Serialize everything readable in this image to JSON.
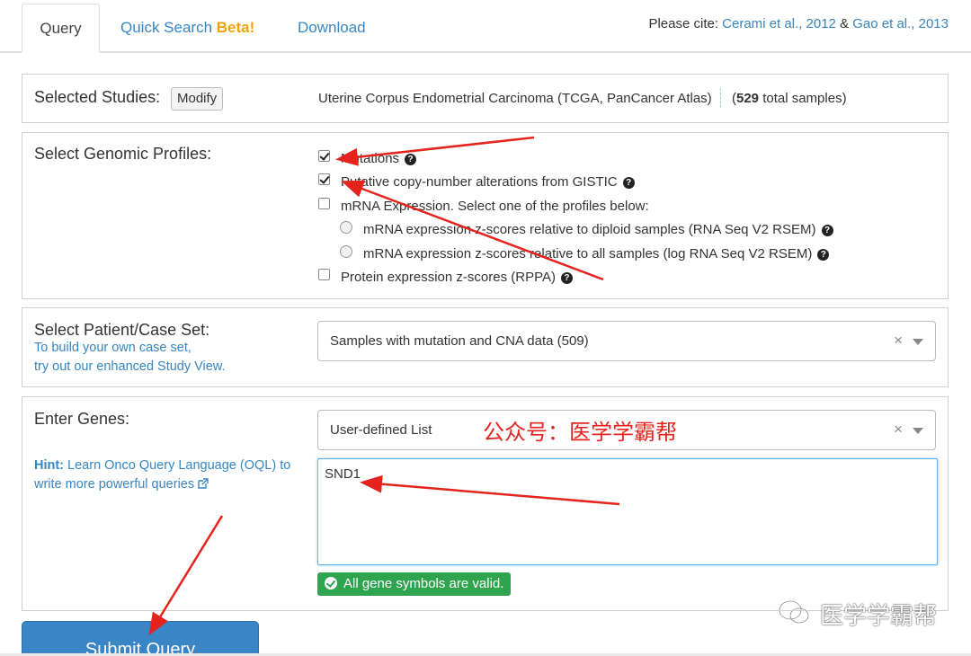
{
  "tabs": {
    "query": "Query",
    "quick_search": "Quick Search",
    "quick_search_badge": "Beta!",
    "download": "Download"
  },
  "cite": {
    "prefix": "Please cite: ",
    "ref1": "Cerami et al., 2012",
    "amp": " & ",
    "ref2": "Gao et al., 2013"
  },
  "studies": {
    "label": "Selected Studies:",
    "modify": "Modify",
    "study_name": "Uterine Corpus Endometrial Carcinoma (TCGA, PanCancer Atlas)",
    "count_open": "(",
    "count": "529",
    "count_suffix": " total samples)"
  },
  "profiles": {
    "label": "Select Genomic Profiles:",
    "options": [
      {
        "label": "Mutations",
        "checked": true
      },
      {
        "label": "Putative copy-number alterations from GISTIC",
        "checked": true
      },
      {
        "label": "mRNA Expression. Select one of the profiles below:",
        "checked": false
      },
      {
        "label": "mRNA expression z-scores relative to diploid samples (RNA Seq V2 RSEM)",
        "selected": false
      },
      {
        "label": "mRNA expression z-scores relative to all samples (log RNA Seq V2 RSEM)",
        "selected": false
      },
      {
        "label": "Protein expression z-scores (RPPA)",
        "checked": false
      }
    ]
  },
  "caseset": {
    "label": "Select Patient/Case Set:",
    "link1": "To build your own case set,",
    "link2": "try out our enhanced Study View.",
    "selected": "Samples with mutation and CNA data (509)"
  },
  "genes": {
    "label": "Enter Genes:",
    "list_selected": "User-defined List",
    "hint_bold": "Hint:",
    "hint_text": " Learn Onco Query Language (OQL) to write more powerful queries",
    "input_value": "SND1",
    "valid_msg": "All gene symbols are valid."
  },
  "submit": "Submit Query",
  "overlay": {
    "red_text": "公众号：医学学霸帮",
    "watermark": "医学学霸帮"
  },
  "colors": {
    "link": "#3786c2",
    "beta": "#f0a30a",
    "valid_bg": "#2ea44f",
    "submit_bg": "#3a85c5",
    "annotation": "#e5231d"
  }
}
